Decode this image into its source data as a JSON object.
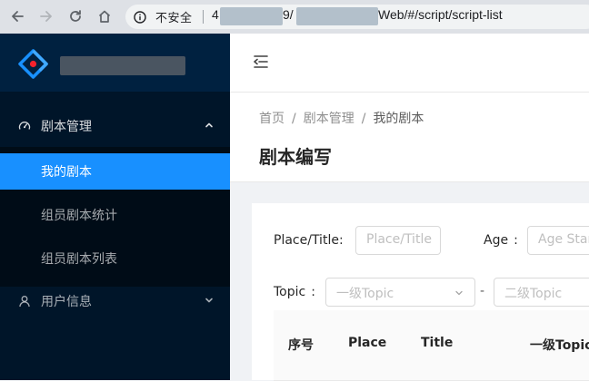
{
  "browser": {
    "security_label": "不安全",
    "url_prefix": "4",
    "url_mid": "9/",
    "url_suffix": "Web/#/script/script-list"
  },
  "sidebar": {
    "menu": [
      {
        "label": "剧本管理",
        "icon": "dashboard-icon",
        "expanded": true,
        "items": [
          {
            "label": "我的剧本",
            "active": true
          },
          {
            "label": "组员剧本统计",
            "active": false
          },
          {
            "label": "组员剧本列表",
            "active": false
          }
        ]
      },
      {
        "label": "用户信息",
        "icon": "user-icon",
        "expanded": false
      }
    ]
  },
  "header": {
    "breadcrumb": [
      "首页",
      "剧本管理",
      "我的剧本"
    ],
    "breadcrumb_separator": "/",
    "page_title": "剧本编写"
  },
  "filters": {
    "place_title": {
      "label": "Place/Title",
      "colon": ":",
      "placeholder": "Place/Title"
    },
    "age": {
      "label": "Age",
      "colon": ":",
      "placeholder": "Age Start"
    },
    "topic": {
      "label": "Topic",
      "colon": ":",
      "level1_placeholder": "一级Topic",
      "range_separator": "-",
      "level2_placeholder": "二级Topic"
    }
  },
  "table": {
    "columns": [
      "序号",
      "Place",
      "Title",
      "一级Topic"
    ]
  },
  "colors": {
    "sidebar_bg": "#001529",
    "submenu_bg": "#000c17",
    "active_item": "#1890ff",
    "page_bg": "#f0f2f5"
  }
}
